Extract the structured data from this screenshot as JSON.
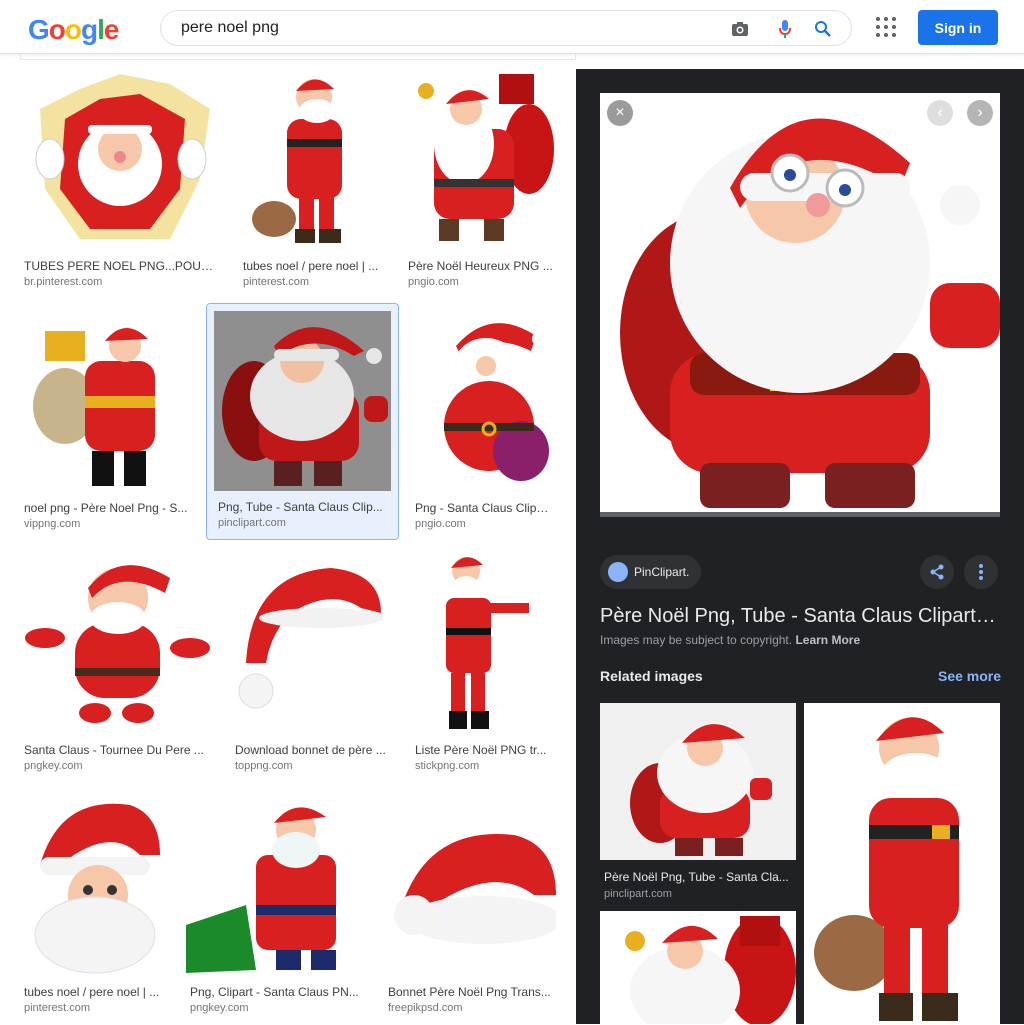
{
  "search": {
    "query": "pere noel png"
  },
  "header": {
    "signin_label": "Sign in",
    "logo_letters": [
      "G",
      "o",
      "o",
      "g",
      "l",
      "e"
    ]
  },
  "results": [
    {
      "title": "TUBES PERE NOEL PNG...POUR ...",
      "source": "br.pinterest.com"
    },
    {
      "title": "tubes noel / pere noel | ...",
      "source": "pinterest.com"
    },
    {
      "title": "Père Noël Heureux PNG ...",
      "source": "pngio.com"
    },
    {
      "title": "noel png - Père Noel Png - S...",
      "source": "vippng.com"
    },
    {
      "title": "Png, Tube - Santa Claus Clip...",
      "source": "pinclipart.com"
    },
    {
      "title": "Png - Santa Claus Clipa...",
      "source": "pngio.com"
    },
    {
      "title": "Santa Claus - Tournee Du Pere ...",
      "source": "pngkey.com"
    },
    {
      "title": "Download bonnet de père ...",
      "source": "toppng.com"
    },
    {
      "title": "Liste Père Noël PNG tr...",
      "source": "stickpng.com"
    },
    {
      "title": "tubes noel / pere noel | ...",
      "source": "pinterest.com"
    },
    {
      "title": "Png, Clipart - Santa Claus PN...",
      "source": "pngkey.com"
    },
    {
      "title": "Bonnet Père Noël Png Trans...",
      "source": "freepikpsd.com"
    }
  ],
  "panel": {
    "source_name": "PinClipart.",
    "title": "Père Noël Png, Tube - Santa Claus Clipart - ...",
    "copyright_text": "Images may be subject to copyright.",
    "learn_more": "Learn More",
    "related_heading": "Related images",
    "see_more": "See more",
    "related": [
      {
        "title": "Père Noël Png, Tube - Santa Cla...",
        "source": "pinclipart.com"
      }
    ]
  },
  "colors": {
    "accent": "#1a73e8",
    "santa_red": "#d7201f",
    "panel_bg": "#202124"
  }
}
